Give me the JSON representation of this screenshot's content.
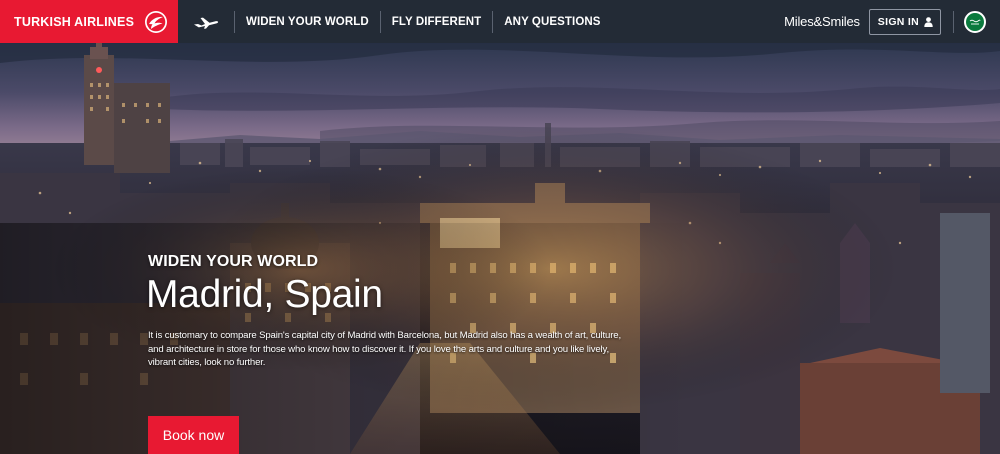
{
  "header": {
    "brand": {
      "name": "TURKISH AIRLINES",
      "color": "#e81932"
    },
    "plane_icon": "airplane-icon",
    "nav": [
      {
        "label": "WIDEN YOUR WORLD"
      },
      {
        "label": "FLY DIFFERENT"
      },
      {
        "label": "ANY QUESTIONS"
      }
    ],
    "miles_label": "Miles&Smiles",
    "signin_label": "SIGN IN",
    "signin_icon": "user-icon",
    "language_flag": "saudi-arabia-flag-icon"
  },
  "hero": {
    "eyebrow": "WIDEN YOUR WORLD",
    "title": "Madrid, Spain",
    "description": "It is customary to compare Spain's capital city of Madrid with Barcelona, but Madrid also has a wealth of art, culture, and architecture in store for those who know how to discover it. If you love the arts and culture and you like lively, vibrant cities, look no further.",
    "cta_label": "Book now",
    "cta_color": "#e81932",
    "background": "night-cityscape-madrid-photo"
  },
  "colors": {
    "topbar": "#232b36",
    "accent": "#e81932"
  }
}
